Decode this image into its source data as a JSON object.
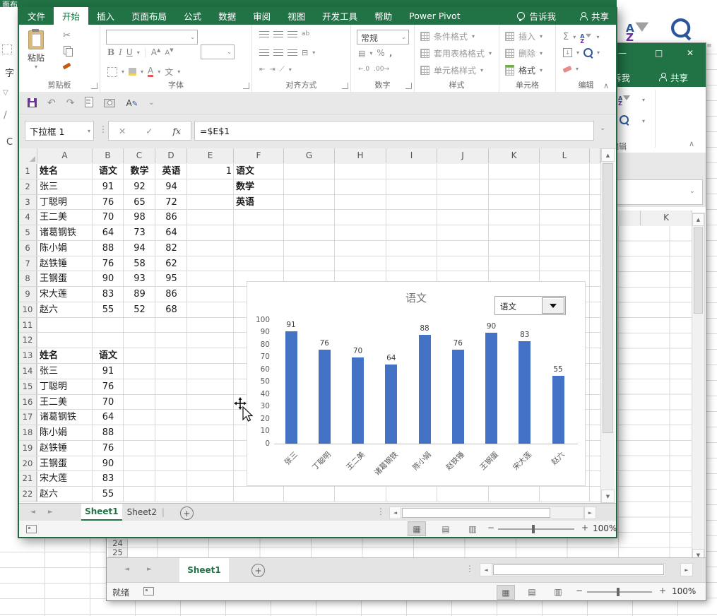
{
  "window": {
    "tabs": [
      "文件",
      "开始",
      "插入",
      "页面布局",
      "公式",
      "数据",
      "审阅",
      "视图",
      "开发工具",
      "帮助",
      "Power Pivot"
    ],
    "active_tab_index": 1,
    "tellme_label": "告诉我",
    "share_label": "共享"
  },
  "ribbon": {
    "groups": [
      "剪贴板",
      "字体",
      "对齐方式",
      "数字",
      "样式",
      "单元格",
      "编辑"
    ],
    "paste": "粘贴",
    "bold": "B",
    "italic": "I",
    "underline": "U",
    "pinyin": "文",
    "number_format": "常规",
    "decimal_inc": ".00",
    "decimal_dec": ".0",
    "style_buttons": [
      "条件格式",
      "套用表格格式",
      "单元格样式"
    ],
    "cell_buttons": [
      "插入",
      "删除",
      "格式"
    ]
  },
  "formula_bar": {
    "name_box": "下拉框 1",
    "fx": "fx",
    "formula": "=$E$1"
  },
  "grid": {
    "columns": [
      {
        "key": "A",
        "w": 78
      },
      {
        "key": "B",
        "w": 44
      },
      {
        "key": "C",
        "w": 45
      },
      {
        "key": "D",
        "w": 45
      },
      {
        "key": "E",
        "w": 66
      },
      {
        "key": "F",
        "w": 71
      },
      {
        "key": "G",
        "w": 72
      },
      {
        "key": "H",
        "w": 73
      },
      {
        "key": "I",
        "w": 72
      },
      {
        "key": "J",
        "w": 73
      },
      {
        "key": "K",
        "w": 72
      },
      {
        "key": "L",
        "w": 71
      }
    ],
    "row_count": 22,
    "cells": [
      {
        "r": 1,
        "c": "A",
        "v": "姓名",
        "b": 1,
        "a": "l"
      },
      {
        "r": 1,
        "c": "B",
        "v": "语文",
        "b": 1,
        "a": "c"
      },
      {
        "r": 1,
        "c": "C",
        "v": "数学",
        "b": 1,
        "a": "c"
      },
      {
        "r": 1,
        "c": "D",
        "v": "英语",
        "b": 1,
        "a": "c"
      },
      {
        "r": 1,
        "c": "E",
        "v": "1",
        "a": "r"
      },
      {
        "r": 1,
        "c": "F",
        "v": "语文",
        "b": 1,
        "a": "l"
      },
      {
        "r": 2,
        "c": "A",
        "v": "张三",
        "a": "l"
      },
      {
        "r": 2,
        "c": "B",
        "v": "91",
        "a": "c"
      },
      {
        "r": 2,
        "c": "C",
        "v": "92",
        "a": "c"
      },
      {
        "r": 2,
        "c": "D",
        "v": "94",
        "a": "c"
      },
      {
        "r": 2,
        "c": "F",
        "v": "数学",
        "b": 1,
        "a": "l"
      },
      {
        "r": 3,
        "c": "A",
        "v": "丁聪明",
        "a": "l"
      },
      {
        "r": 3,
        "c": "B",
        "v": "76",
        "a": "c"
      },
      {
        "r": 3,
        "c": "C",
        "v": "65",
        "a": "c"
      },
      {
        "r": 3,
        "c": "D",
        "v": "72",
        "a": "c"
      },
      {
        "r": 3,
        "c": "F",
        "v": "英语",
        "b": 1,
        "a": "l"
      },
      {
        "r": 4,
        "c": "A",
        "v": "王二美",
        "a": "l"
      },
      {
        "r": 4,
        "c": "B",
        "v": "70",
        "a": "c"
      },
      {
        "r": 4,
        "c": "C",
        "v": "98",
        "a": "c"
      },
      {
        "r": 4,
        "c": "D",
        "v": "86",
        "a": "c"
      },
      {
        "r": 5,
        "c": "A",
        "v": "诸葛钢铁",
        "a": "l"
      },
      {
        "r": 5,
        "c": "B",
        "v": "64",
        "a": "c"
      },
      {
        "r": 5,
        "c": "C",
        "v": "73",
        "a": "c"
      },
      {
        "r": 5,
        "c": "D",
        "v": "64",
        "a": "c"
      },
      {
        "r": 6,
        "c": "A",
        "v": "陈小娟",
        "a": "l"
      },
      {
        "r": 6,
        "c": "B",
        "v": "88",
        "a": "c"
      },
      {
        "r": 6,
        "c": "C",
        "v": "94",
        "a": "c"
      },
      {
        "r": 6,
        "c": "D",
        "v": "82",
        "a": "c"
      },
      {
        "r": 7,
        "c": "A",
        "v": "赵铁锤",
        "a": "l"
      },
      {
        "r": 7,
        "c": "B",
        "v": "76",
        "a": "c"
      },
      {
        "r": 7,
        "c": "C",
        "v": "58",
        "a": "c"
      },
      {
        "r": 7,
        "c": "D",
        "v": "62",
        "a": "c"
      },
      {
        "r": 8,
        "c": "A",
        "v": "王钢蛋",
        "a": "l"
      },
      {
        "r": 8,
        "c": "B",
        "v": "90",
        "a": "c"
      },
      {
        "r": 8,
        "c": "C",
        "v": "93",
        "a": "c"
      },
      {
        "r": 8,
        "c": "D",
        "v": "95",
        "a": "c"
      },
      {
        "r": 9,
        "c": "A",
        "v": "宋大莲",
        "a": "l"
      },
      {
        "r": 9,
        "c": "B",
        "v": "83",
        "a": "c"
      },
      {
        "r": 9,
        "c": "C",
        "v": "89",
        "a": "c"
      },
      {
        "r": 9,
        "c": "D",
        "v": "86",
        "a": "c"
      },
      {
        "r": 10,
        "c": "A",
        "v": "赵六",
        "a": "l"
      },
      {
        "r": 10,
        "c": "B",
        "v": "55",
        "a": "c"
      },
      {
        "r": 10,
        "c": "C",
        "v": "52",
        "a": "c"
      },
      {
        "r": 10,
        "c": "D",
        "v": "68",
        "a": "c"
      },
      {
        "r": 13,
        "c": "A",
        "v": "姓名",
        "b": 1,
        "a": "l"
      },
      {
        "r": 13,
        "c": "B",
        "v": "语文",
        "b": 1,
        "a": "c"
      },
      {
        "r": 14,
        "c": "A",
        "v": "张三",
        "a": "l"
      },
      {
        "r": 14,
        "c": "B",
        "v": "91",
        "a": "c"
      },
      {
        "r": 15,
        "c": "A",
        "v": "丁聪明",
        "a": "l"
      },
      {
        "r": 15,
        "c": "B",
        "v": "76",
        "a": "c"
      },
      {
        "r": 16,
        "c": "A",
        "v": "王二美",
        "a": "l"
      },
      {
        "r": 16,
        "c": "B",
        "v": "70",
        "a": "c"
      },
      {
        "r": 17,
        "c": "A",
        "v": "诸葛钢铁",
        "a": "l"
      },
      {
        "r": 17,
        "c": "B",
        "v": "64",
        "a": "c"
      },
      {
        "r": 18,
        "c": "A",
        "v": "陈小娟",
        "a": "l"
      },
      {
        "r": 18,
        "c": "B",
        "v": "88",
        "a": "c"
      },
      {
        "r": 19,
        "c": "A",
        "v": "赵铁锤",
        "a": "l"
      },
      {
        "r": 19,
        "c": "B",
        "v": "76",
        "a": "c"
      },
      {
        "r": 20,
        "c": "A",
        "v": "王钢蛋",
        "a": "l"
      },
      {
        "r": 20,
        "c": "B",
        "v": "90",
        "a": "c"
      },
      {
        "r": 21,
        "c": "A",
        "v": "宋大莲",
        "a": "l"
      },
      {
        "r": 21,
        "c": "B",
        "v": "83",
        "a": "c"
      },
      {
        "r": 22,
        "c": "A",
        "v": "赵六",
        "a": "l"
      },
      {
        "r": 22,
        "c": "B",
        "v": "55",
        "a": "c"
      }
    ]
  },
  "chart_data": {
    "type": "bar",
    "title": "语文",
    "categories": [
      "张三",
      "丁聪明",
      "王二美",
      "诸葛钢铁",
      "陈小娟",
      "赵铁锤",
      "王钢蛋",
      "宋大莲",
      "赵六"
    ],
    "values": [
      91,
      76,
      70,
      64,
      88,
      76,
      90,
      83,
      55
    ],
    "ylim": [
      0,
      100
    ],
    "ytick_step": 10,
    "grid": false,
    "legend": "none",
    "bar_color": "#4472C4",
    "combo_value": "语文"
  },
  "sheet_bar": {
    "tabs": [
      "Sheet1",
      "Sheet2"
    ],
    "active": "Sheet1"
  },
  "status_bar": {
    "zoom": "100%"
  },
  "bg": {
    "outer": {
      "tab_fragment": "面布",
      "font_fragment": "字",
      "corner_letter": "C"
    },
    "mid": {
      "tellme_fragment": "诉我",
      "share": "共享",
      "edit_group": "编辑",
      "col_header": "K",
      "rows": [
        "24",
        "25"
      ],
      "sheet_tab": "Sheet1",
      "ready": "就绪",
      "zoom": "100%"
    }
  },
  "icons": {
    "cut": "✂",
    "undo": "↶",
    "redo": "↷",
    "sigma": "Σ",
    "percent": "%",
    "comma": ",",
    "dropdown": "▾",
    "chevron-down": "⌄",
    "collapse": "∧",
    "minimize": "—",
    "maximize": "□",
    "close": "✕",
    "prev-sheet": "◄",
    "next-sheet": "►",
    "add-sheet": "+",
    "ellipsis": "⋮",
    "scroll-left": "◄",
    "scroll-right": "►",
    "scroll-up": "▲",
    "scroll-down": "▼",
    "view-normal": "▦",
    "view-layout": "▤",
    "view-break": "▥",
    "zoom-out": "−",
    "zoom-in": "+",
    "merge": "⊟",
    "wrap": "ab",
    "fill-down": "↓"
  }
}
